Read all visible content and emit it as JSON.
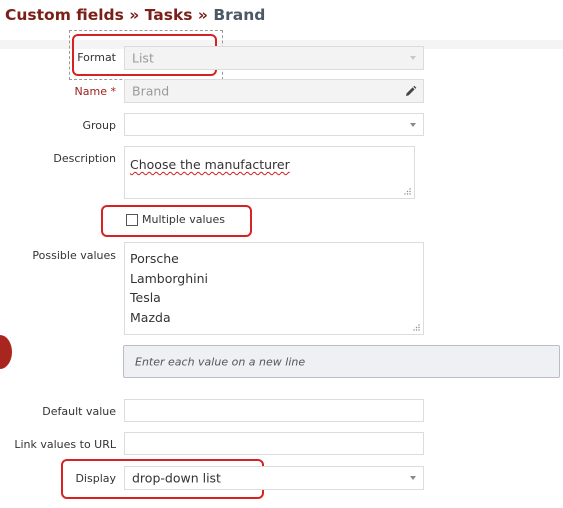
{
  "breadcrumb": {
    "items": [
      "Custom fields",
      "Tasks"
    ],
    "separator": "»",
    "current": "Brand"
  },
  "form": {
    "format": {
      "label": "Format",
      "value": "List"
    },
    "name": {
      "label": "Name",
      "required_mark": "*",
      "value": "Brand"
    },
    "group": {
      "label": "Group",
      "value": ""
    },
    "description": {
      "label": "Description",
      "value": "Choose the manufacturer"
    },
    "multiple_values": {
      "label": "Multiple values",
      "checked": false
    },
    "possible_values": {
      "label": "Possible values",
      "values": [
        "Porsche",
        "Lamborghini",
        "Tesla",
        "Mazda"
      ],
      "hint": "Enter each value on a new line"
    },
    "default_value": {
      "label": "Default value",
      "value": ""
    },
    "link_values_to_url": {
      "label": "Link values to URL",
      "value": ""
    },
    "display": {
      "label": "Display",
      "value": "drop-down list"
    }
  },
  "colors": {
    "breadcrumb_link": "#7a2018",
    "annotation_red": "#d82222",
    "required_label": "#a02020"
  }
}
